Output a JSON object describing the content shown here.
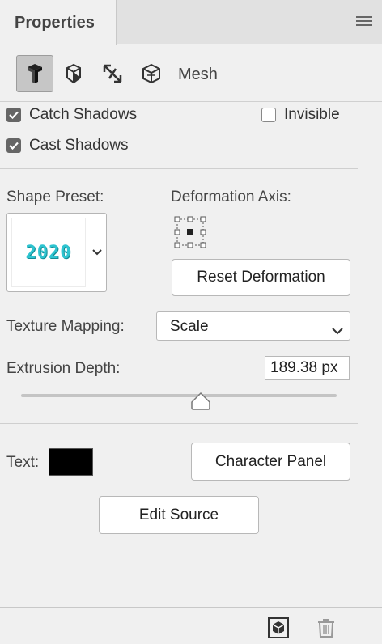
{
  "panel": {
    "tab_title": "Properties",
    "menu_icon": "hamburger-menu-icon"
  },
  "toolbar": {
    "tools": [
      {
        "icon": "3d-object-icon",
        "active": true
      },
      {
        "icon": "3d-deform-icon",
        "active": false
      },
      {
        "icon": "3d-cap-icon",
        "active": false
      },
      {
        "icon": "3d-coordinates-icon",
        "active": false
      }
    ],
    "label": "Mesh"
  },
  "shadows": {
    "catch_label": "Catch Shadows",
    "catch_checked": true,
    "invisible_label": "Invisible",
    "invisible_checked": false,
    "cast_label": "Cast Shadows",
    "cast_checked": true
  },
  "shape": {
    "preset_label": "Shape Preset:",
    "preset_text": "2020",
    "deformation_label": "Deformation Axis:",
    "reset_button": "Reset Deformation"
  },
  "texture": {
    "label": "Texture Mapping:",
    "value": "Scale"
  },
  "extrusion": {
    "label": "Extrusion Depth:",
    "value": "189.38 px",
    "slider_fraction": 0.57
  },
  "text_section": {
    "label": "Text:",
    "color": "#000000",
    "character_panel_button": "Character Panel",
    "edit_source_button": "Edit Source"
  },
  "footer": {
    "icons": [
      "render-icon",
      "trash-icon"
    ]
  },
  "colors": {
    "accent_checkbox": "#666666",
    "preset_text": "#2ec4d0"
  }
}
